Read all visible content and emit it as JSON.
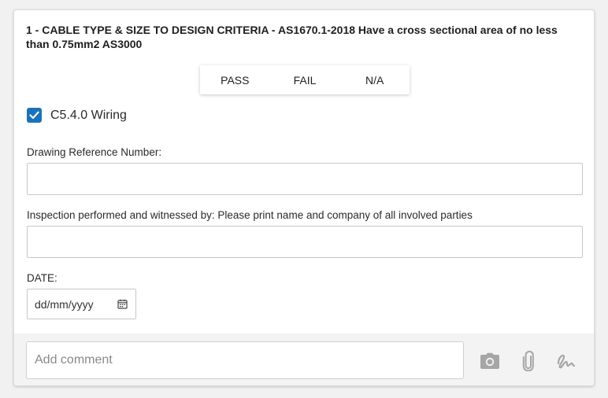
{
  "question": {
    "title": "1 - CABLE TYPE & SIZE TO DESIGN CRITERIA - AS1670.1-2018 Have a cross sectional area of no less than 0.75mm2 AS3000"
  },
  "result_options": {
    "pass": "PASS",
    "fail": "FAIL",
    "na": "N/A"
  },
  "checkbox": {
    "label": "C5.4.0 Wiring",
    "checked": true
  },
  "fields": {
    "drawing_ref_label": "Drawing Reference Number:",
    "drawing_ref_value": "",
    "inspection_label": "Inspection performed and witnessed by: Please print name and company of all involved parties",
    "inspection_value": "",
    "date_label": "DATE:",
    "date_placeholder": "dd/mm/yyyy"
  },
  "footer": {
    "comment_placeholder": "Add comment",
    "icons": [
      "camera-icon",
      "paperclip-icon",
      "signature-icon"
    ]
  },
  "colors": {
    "checkbox": "#1a73b8",
    "footer_bg": "#f3f3f3",
    "icon": "#a6a6a6"
  }
}
